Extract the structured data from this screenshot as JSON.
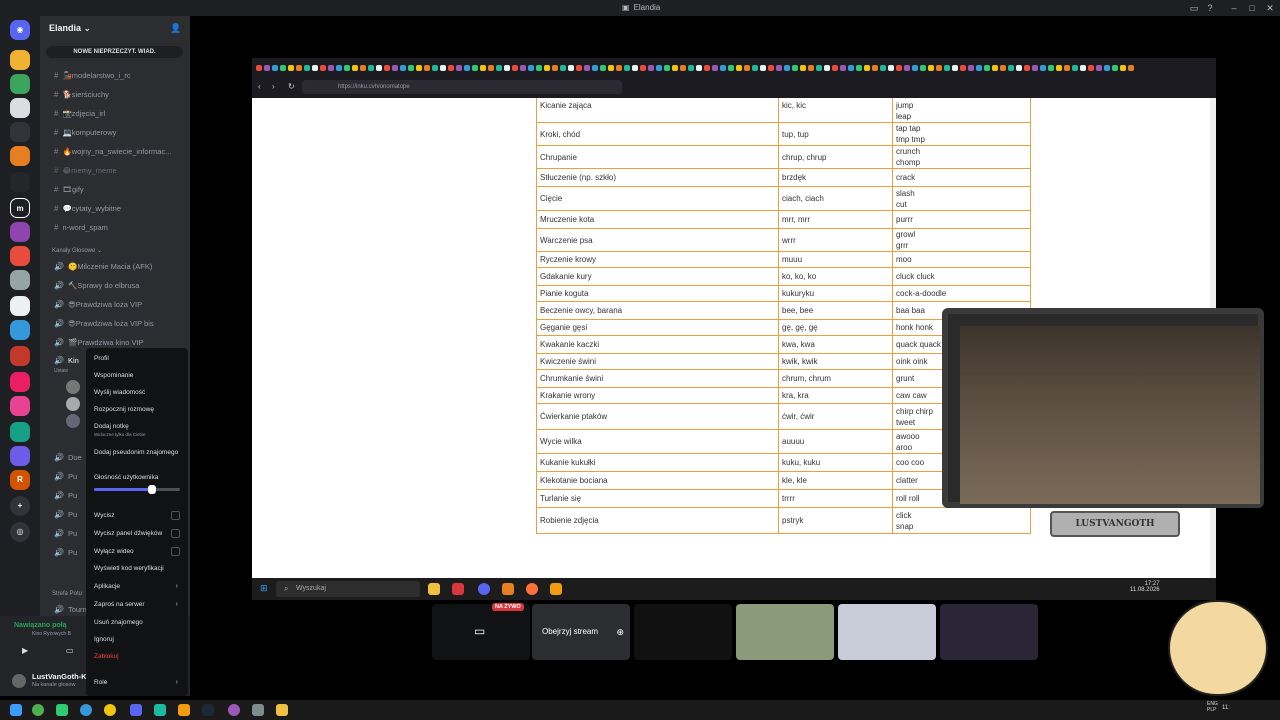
{
  "window": {
    "title": "Elandia"
  },
  "guild": {
    "name": "Elandia",
    "new_unread": "NOWE NIEPRZECZYT. WIAD."
  },
  "channels": [
    {
      "name": "modelarstwo_i_rc",
      "emoji": "🚂"
    },
    {
      "name": "sierściuchy",
      "emoji": "🐕"
    },
    {
      "name": "zdjęcia_irl",
      "emoji": "📸"
    },
    {
      "name": "komputerowy",
      "emoji": "💻"
    },
    {
      "name": "wojny_na_swiecie_informac...",
      "emoji": "🔥"
    },
    {
      "name": "memy_meme",
      "emoji": "😂"
    },
    {
      "name": "gify",
      "emoji": "🎞"
    },
    {
      "name": "cytaty_wybitne",
      "emoji": "💬"
    },
    {
      "name": "n-word_spam",
      "emoji": ""
    }
  ],
  "voice_category": "Kanały Głosowe",
  "voice_channels": [
    {
      "name": "Milczenie Macia (AFK)",
      "emoji": "🤫"
    },
    {
      "name": "Sprawy do elbrusa",
      "emoji": "🔨"
    },
    {
      "name": "Prawdziwa loża VIP",
      "emoji": "😎"
    },
    {
      "name": "Prawdziwa loża VIP bis",
      "emoji": "😎"
    },
    {
      "name": "Prawdziwa kino VIP",
      "emoji": "🎬"
    }
  ],
  "context_menu": {
    "profile": "Profil",
    "mentions": "Wspominanie",
    "send_message": "Wyślij wiadomość",
    "start_call": "Rozpocznij rozmowę",
    "add_note": "Dodaj notkę",
    "add_note_sub": "Widoczne tylko dla Ciebie",
    "add_nickname": "Dodaj pseudonim znajomego",
    "user_volume": "Głośność użytkownika",
    "volume_level": 0.68,
    "mute": "Wycisz",
    "mute_soundboard": "Wycisz panel dźwięków",
    "disable_video": "Wyłącz wideo",
    "show_verify": "Wyświetl kod weryfikacji",
    "apps": "Aplikacje",
    "invite": "Zaproś na serwer",
    "remove_friend": "Usuń znajomego",
    "ignore": "Ignoruj",
    "block": "Zablokuj",
    "roles": "Role"
  },
  "partial_labels": {
    "cut_voice": "Kin",
    "cut_voice_sub": "Ustaw",
    "due": "Due",
    "pu": "Pu",
    "zone": "Strefa Potu",
    "tourn": "Tourn"
  },
  "voice_status": {
    "connected": "Nawiązano połą",
    "sub": "Kino Ryżowych B"
  },
  "user": {
    "name": "LustVanGoth-K",
    "status": "Na kanale głosow"
  },
  "browser": {
    "url": "https://inku.cvh/onomatope"
  },
  "sounds_table": [
    [
      "Kicanie zająca",
      "kic, kic",
      "hop\njump\nleap"
    ],
    [
      "Kroki, chód",
      "tup, tup",
      "tap tap\ntmp tmp"
    ],
    [
      "Chrupanie",
      "chrup, chrup",
      "crunch\nchomp"
    ],
    [
      "Stłuczenie (np. szkło)",
      "brzdęk",
      "crack"
    ],
    [
      "Cięcie",
      "ciach, ciach",
      "slash\ncut"
    ],
    [
      "Mruczenie kota",
      "mrr, mrr",
      "purrr"
    ],
    [
      "Warczenie psa",
      "wrrr",
      "growl\ngrrr"
    ],
    [
      "Ryczenie krowy",
      "muuu",
      "moo"
    ],
    [
      "Gdakanie kury",
      "ko, ko, ko",
      "cluck cluck"
    ],
    [
      "Pianie koguta",
      "kukuryku",
      "cock-a-doodle"
    ],
    [
      "Beczenie owcy, barana",
      "bee, bee",
      "baa baa"
    ],
    [
      "Gęganie gęsi",
      "gę, gę, gę",
      "honk honk"
    ],
    [
      "Kwakanie kaczki",
      "kwa, kwa",
      "quack quack"
    ],
    [
      "Kwiczenie świni",
      "kwik, kwik",
      "oink oink"
    ],
    [
      "Chrumkanie świni",
      "chrum, chrum",
      "grunt"
    ],
    [
      "Krakanie wrony",
      "kra, kra",
      "caw caw"
    ],
    [
      "Ćwierkanie ptaków",
      "ćwir, ćwir",
      "chirp chirp\ntweet"
    ],
    [
      "Wycie wilka",
      "auuuu",
      "awooo\naroo"
    ],
    [
      "Kukanie kukułki",
      "kuku, kuku",
      "coo coo"
    ],
    [
      "Klekotanie bociana",
      "kle, kle",
      "clatter"
    ],
    [
      "Turlanie się",
      "trrrr",
      "roll roll"
    ],
    [
      "Robienie zdjęcia",
      "pstryk",
      "click\nsnap"
    ]
  ],
  "taskbar": {
    "search": "Wyszukaj",
    "time": "17:27",
    "date": "11.08.2026"
  },
  "webcam": {
    "label": "LUSTVANGOTH"
  },
  "stream": {
    "live": "NA ŻYWO",
    "watch": "Obejrzyj stream"
  },
  "lang": {
    "lang": "ENG",
    "layout": "PLP",
    "time2": "11:"
  }
}
